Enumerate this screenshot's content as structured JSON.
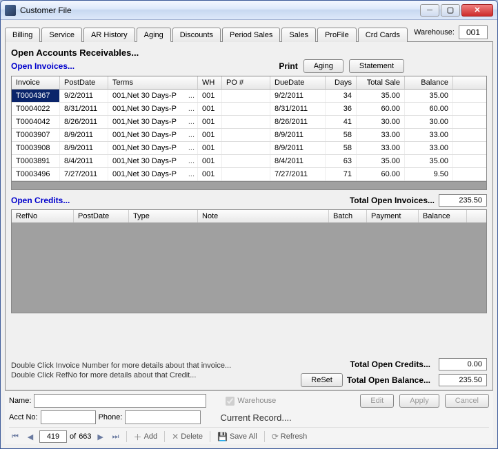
{
  "window": {
    "title": "Customer File"
  },
  "warehouse": {
    "label": "Warehouse:",
    "value": "001"
  },
  "tabs": [
    {
      "label": "Billing"
    },
    {
      "label": "Service"
    },
    {
      "label": "AR History"
    },
    {
      "label": "Aging"
    },
    {
      "label": "Discounts"
    },
    {
      "label": "Period Sales"
    },
    {
      "label": "Sales"
    },
    {
      "label": "ProFile"
    },
    {
      "label": "Crd Cards"
    }
  ],
  "active_tab": "Aging",
  "section": {
    "title": "Open Accounts Receivables...",
    "open_invoices": "Open Invoices...",
    "open_credits": "Open Credits...",
    "print": "Print",
    "btn_aging": "Aging",
    "btn_statement": "Statement"
  },
  "invoice_headers": {
    "invoice": "Invoice",
    "postdate": "PostDate",
    "terms": "Terms",
    "wh": "WH",
    "po": "PO #",
    "due": "DueDate",
    "days": "Days",
    "total": "Total Sale",
    "balance": "Balance"
  },
  "invoices": [
    {
      "inv": "T0004367",
      "post": "9/2/2011",
      "terms": "001,Net 30 Days-P",
      "wh": "001",
      "po": "",
      "due": "9/2/2011",
      "days": "34",
      "total": "35.00",
      "bal": "35.00"
    },
    {
      "inv": "T0004022",
      "post": "8/31/2011",
      "terms": "001,Net 30 Days-P",
      "wh": "001",
      "po": "",
      "due": "8/31/2011",
      "days": "36",
      "total": "60.00",
      "bal": "60.00"
    },
    {
      "inv": "T0004042",
      "post": "8/26/2011",
      "terms": "001,Net 30 Days-P",
      "wh": "001",
      "po": "",
      "due": "8/26/2011",
      "days": "41",
      "total": "30.00",
      "bal": "30.00"
    },
    {
      "inv": "T0003907",
      "post": "8/9/2011",
      "terms": "001,Net 30 Days-P",
      "wh": "001",
      "po": "",
      "due": "8/9/2011",
      "days": "58",
      "total": "33.00",
      "bal": "33.00"
    },
    {
      "inv": "T0003908",
      "post": "8/9/2011",
      "terms": "001,Net 30 Days-P",
      "wh": "001",
      "po": "",
      "due": "8/9/2011",
      "days": "58",
      "total": "33.00",
      "bal": "33.00"
    },
    {
      "inv": "T0003891",
      "post": "8/4/2011",
      "terms": "001,Net 30 Days-P",
      "wh": "001",
      "po": "",
      "due": "8/4/2011",
      "days": "63",
      "total": "35.00",
      "bal": "35.00"
    },
    {
      "inv": "T0003496",
      "post": "7/27/2011",
      "terms": "001,Net 30 Days-P",
      "wh": "001",
      "po": "",
      "due": "7/27/2011",
      "days": "71",
      "total": "60.00",
      "bal": "9.50"
    }
  ],
  "credit_headers": {
    "ref": "RefNo",
    "post": "PostDate",
    "type": "Type",
    "note": "Note",
    "batch": "Batch",
    "payment": "Payment",
    "balance": "Balance"
  },
  "totals": {
    "open_invoices_lbl": "Total Open Invoices...",
    "open_invoices_val": "235.50",
    "open_credits_lbl": "Total Open Credits...",
    "open_credits_val": "0.00",
    "open_balance_lbl": "Total Open Balance...",
    "open_balance_val": "235.50",
    "reset": "ReSet"
  },
  "hints": {
    "l1": "Double Click Invoice Number for more details about that invoice...",
    "l2": "Double Click RefNo for more details about that Credit..."
  },
  "footer": {
    "name_lbl": "Name:",
    "acct_lbl": "Acct No:",
    "phone_lbl": "Phone:",
    "wh_chk": "Warehouse",
    "record": "Current Record....",
    "edit": "Edit",
    "apply": "Apply",
    "cancel": "Cancel"
  },
  "nav": {
    "pos": "419",
    "of": "of",
    "total": "663",
    "add": "Add",
    "delete": "Delete",
    "saveall": "Save All",
    "refresh": "Refresh"
  }
}
